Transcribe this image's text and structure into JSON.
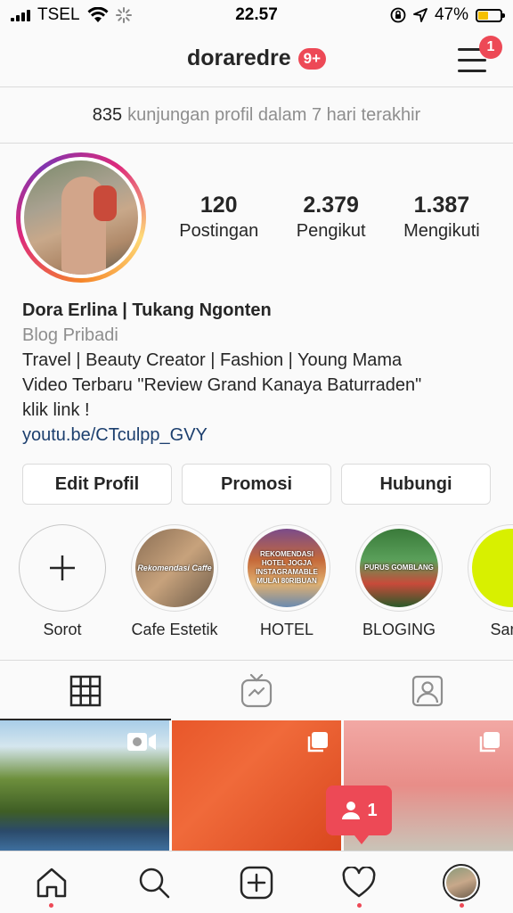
{
  "status_bar": {
    "carrier": "TSEL",
    "time": "22.57",
    "battery": "47%",
    "battery_color": "#f5c000"
  },
  "header": {
    "username": "doraredre",
    "notification_badge": "9+",
    "menu_badge": "1",
    "badge_color": "#ed4956"
  },
  "visits": {
    "count": "835",
    "text": "kunjungan profil dalam 7 hari terakhir"
  },
  "stats": [
    {
      "value": "120",
      "label": "Postingan"
    },
    {
      "value": "2.379",
      "label": "Pengikut"
    },
    {
      "value": "1.387",
      "label": "Mengikuti"
    }
  ],
  "bio": {
    "name": "Dora Erlina | Tukang Ngonten",
    "category": "Blog Pribadi",
    "line1": "Travel | Beauty Creator | Fashion | Young Mama",
    "line2": "Video Terbaru \"Review Grand Kanaya Baturraden\"",
    "line3": "klik link !",
    "link": "youtu.be/CTculpp_GVY"
  },
  "buttons": {
    "edit": "Edit Profil",
    "promote": "Promosi",
    "contact": "Hubungi"
  },
  "highlights": [
    {
      "label": "Sorot",
      "icon": "plus-icon"
    },
    {
      "label": "Cafe Estetik",
      "overlay": "Rekomendasi Caffe"
    },
    {
      "label": "HOTEL",
      "overlay": "REKOMENDASI HOTEL JOGJA INSTAGRAMABLE MULAI 80RIBUAN"
    },
    {
      "label": "BLOGING",
      "overlay": "PURUS GOMBLANG"
    },
    {
      "label": "Samb",
      "overlay": ""
    }
  ],
  "tabs": [
    {
      "name": "grid-icon",
      "active": true
    },
    {
      "name": "igtv-icon",
      "active": false
    },
    {
      "name": "tagged-icon",
      "active": false
    }
  ],
  "follow_notification": {
    "count": "1"
  },
  "bottom_nav": [
    {
      "name": "home-icon"
    },
    {
      "name": "search-icon"
    },
    {
      "name": "new-post-icon"
    },
    {
      "name": "activity-icon"
    },
    {
      "name": "profile-avatar"
    }
  ]
}
